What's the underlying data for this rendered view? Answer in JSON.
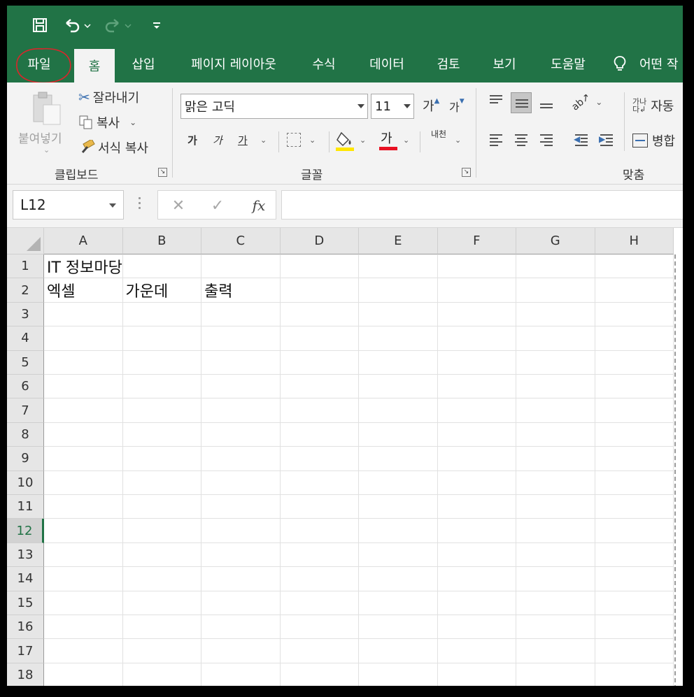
{
  "qat": {
    "save_icon": "save-icon",
    "undo_icon": "undo-icon",
    "redo_icon": "redo-icon",
    "customize_icon": "customize-qat-icon"
  },
  "tabs": [
    {
      "label": "파일"
    },
    {
      "label": "홈"
    },
    {
      "label": "삽입"
    },
    {
      "label": "페이지 레이아웃"
    },
    {
      "label": "수식"
    },
    {
      "label": "데이터"
    },
    {
      "label": "검토"
    },
    {
      "label": "보기"
    },
    {
      "label": "도움말"
    }
  ],
  "tellme": {
    "label": "어떤 작",
    "icon": "lightbulb-icon"
  },
  "ribbon": {
    "clipboard": {
      "paste_label": "붙여넣기",
      "cut_label": "잘라내기",
      "copy_label": "복사",
      "format_painter_label": "서식 복사",
      "group_label": "클립보드"
    },
    "font": {
      "font_name": "맑은 고딕",
      "font_size": "11",
      "increase_label": "가",
      "decrease_label": "가",
      "bold_label": "가",
      "italic_label": "가",
      "underline_label": "가",
      "font_color_label": "가",
      "phonetic_label": "내천",
      "group_label": "글꼴",
      "highlight_color": "#ffe600",
      "font_color": "#e81123"
    },
    "alignment": {
      "wrap_label": "자동",
      "merge_label": "병합",
      "group_label": "맞춤"
    }
  },
  "formula_bar": {
    "name_box": "L12",
    "fx_label": "fx",
    "formula_value": ""
  },
  "grid": {
    "columns": [
      "A",
      "B",
      "C",
      "D",
      "E",
      "F",
      "G",
      "H"
    ],
    "rows": [
      "1",
      "2",
      "3",
      "4",
      "5",
      "6",
      "7",
      "8",
      "9",
      "10",
      "11",
      "12",
      "13",
      "14",
      "15",
      "16",
      "17",
      "18"
    ],
    "selected_row": "12",
    "cells": {
      "A1": "IT 정보마당",
      "A2": "엑셀",
      "B2": "가운데",
      "C2": "출력"
    }
  },
  "colors": {
    "brand": "#217346",
    "annotation": "#d9262b"
  }
}
